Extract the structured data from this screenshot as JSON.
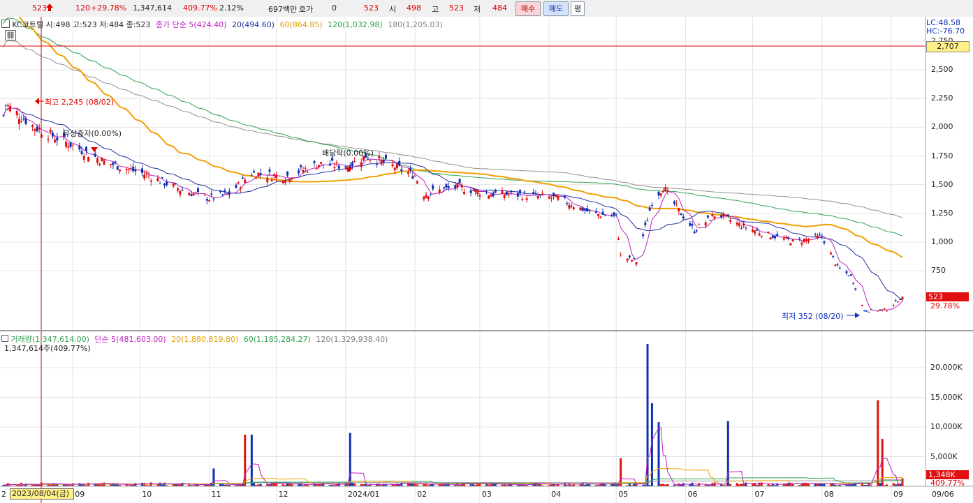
{
  "top_bar": {
    "price": "523",
    "up_arrow_icon": "arrow-up-icon",
    "change": "120",
    "change_pct": "+29.78%",
    "volume": "1,347,614",
    "volume_ratio": "409.77%",
    "turnover": "2.12%",
    "amount": "697백만",
    "hoga_label": "호가",
    "hoga_value": "0",
    "ask": "523",
    "open_label": "시",
    "open": "498",
    "high_label": "고",
    "high": "523",
    "low_label": "저",
    "low": "484",
    "buy_button": "매수",
    "sell_button": "매도",
    "eval_button": "평"
  },
  "price_panel": {
    "stock_info": "KC코트렐 시:498 고:523 저:484 종:523",
    "ma_label": "종가 단순 5(424.40)",
    "ma20": "20(494.60)",
    "ma60": "60(864.85)",
    "ma120": "120(1,032.98)",
    "ma180": "180(1,205.03)",
    "lc": "LC:48.58",
    "hc": "HC:-76.70",
    "hline_value": "2,707",
    "current_value": "523",
    "current_pct": "29.78%",
    "y_ticks": [
      "2,750",
      "2,500",
      "2,250",
      "2,000",
      "1,750",
      "1,500",
      "1,250",
      "1,000",
      "750"
    ],
    "annotations": {
      "high": "최고 2,245 (08/02)",
      "rights": "유상증자(0.00%)",
      "dividend": "배당락(0.00%)",
      "low": "최저 352 (08/20)"
    }
  },
  "volume_panel": {
    "vol_label": "거래량(1,347,614.00)",
    "ma5_label": "단순 5(481,603.00)",
    "ma20_label": "20(1,880,819.80)",
    "ma60_label": "60(1,185,284.27)",
    "ma120_label": "120(1,329,938.40)",
    "vol_summary": "1,347,614주(409.77%)",
    "y_ticks": [
      "20,000K",
      "15,000K",
      "10,000K",
      "5,000K"
    ],
    "current_value": "1,348K",
    "current_pct": "409.77%"
  },
  "x_axis": {
    "cursor_date": "2023/08/04(금)",
    "first_label": "2",
    "months": [
      "09",
      "10",
      "11",
      "12",
      "2024/01",
      "02",
      "03",
      "04",
      "05",
      "06",
      "07",
      "08",
      "09"
    ],
    "right_label": "09/06"
  },
  "colors": {
    "up": "#e01010",
    "down": "#1030b0",
    "ma5": "#c020c0",
    "ma20": "#2030a0",
    "ma60": "#f0a000",
    "ma120": "#30a050",
    "ma180": "#909090"
  },
  "chart_data": {
    "type": "line",
    "series": [
      {
        "name": "종가",
        "x": [
          "2023-08-01",
          "2023-08-02",
          "2023-08-15",
          "2023-08-31",
          "2023-09-15",
          "2023-10-05",
          "2023-10-20",
          "2023-11-01",
          "2023-11-10",
          "2023-11-20",
          "2023-12-05",
          "2023-12-20",
          "2024-01-02",
          "2024-01-10",
          "2024-01-20",
          "2024-02-01",
          "2024-02-05",
          "2024-02-20",
          "2024-03-05",
          "2024-03-20",
          "2024-04-05",
          "2024-04-20",
          "2024-05-01",
          "2024-05-03",
          "2024-05-10",
          "2024-05-17",
          "2024-05-22",
          "2024-05-28",
          "2024-06-05",
          "2024-06-15",
          "2024-06-25",
          "2024-07-05",
          "2024-07-20",
          "2024-08-01",
          "2024-08-08",
          "2024-08-14",
          "2024-08-20",
          "2024-08-30",
          "2024-09-06"
        ],
        "y": [
          2100,
          2200,
          2000,
          1850,
          1700,
          1580,
          1450,
          1380,
          1420,
          1600,
          1570,
          1680,
          1660,
          1750,
          1680,
          1580,
          1420,
          1480,
          1420,
          1410,
          1380,
          1250,
          1220,
          880,
          830,
          1350,
          1480,
          1300,
          1100,
          1250,
          1150,
          1080,
          1000,
          1050,
          780,
          700,
          400,
          410,
          523
        ]
      }
    ],
    "volume_series": {
      "name": "거래량",
      "x": [
        "2023-11-03",
        "2023-11-17",
        "2023-11-20",
        "2024-01-03",
        "2024-05-03",
        "2024-05-15",
        "2024-05-17",
        "2024-05-20",
        "2024-06-20",
        "2024-08-26",
        "2024-08-28",
        "2024-09-06"
      ],
      "y": [
        3000,
        8700,
        8700,
        9000,
        4700,
        24000,
        14000,
        10800,
        11000,
        14500,
        8000,
        1348
      ]
    },
    "ylim": [
      300,
      2900
    ],
    "volume_ylim": [
      0,
      24500
    ]
  }
}
